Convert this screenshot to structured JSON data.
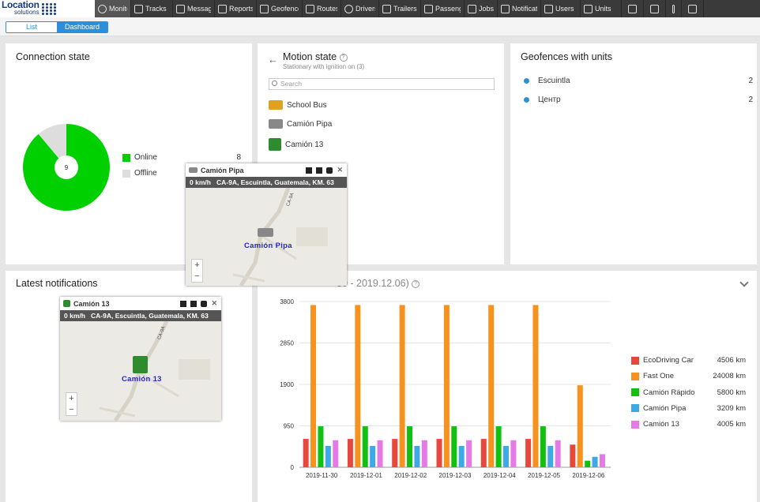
{
  "app": {
    "logo_line1": "Location",
    "logo_line2": "solutions"
  },
  "nav": [
    {
      "label": "Monitoring",
      "icon": "globe-icon",
      "active": true
    },
    {
      "label": "Tracks",
      "icon": "map-icon"
    },
    {
      "label": "Messages",
      "icon": "envelope-icon"
    },
    {
      "label": "Reports",
      "icon": "report-icon"
    },
    {
      "label": "Geofences",
      "icon": "geofence-icon"
    },
    {
      "label": "Routes",
      "icon": "route-icon"
    },
    {
      "label": "Drivers",
      "icon": "steering-wheel-icon"
    },
    {
      "label": "Trailers",
      "icon": "trailer-icon"
    },
    {
      "label": "Passengers",
      "icon": "passenger-icon"
    },
    {
      "label": "Jobs",
      "icon": "jobs-icon"
    },
    {
      "label": "Notifications",
      "icon": "alarm-icon"
    },
    {
      "label": "Users",
      "icon": "user-icon"
    },
    {
      "label": "Units",
      "icon": "bus-icon"
    }
  ],
  "nav_extra": [
    "ruler-icon",
    "grid-icon",
    "more-icon",
    "account-icon"
  ],
  "view_toggle": {
    "list": "List",
    "dashboard": "Dashboard",
    "selected": "dashboard"
  },
  "connection": {
    "title": "Connection state",
    "center": "9",
    "items": [
      {
        "label": "Online",
        "value": "8",
        "color": "#00d000"
      },
      {
        "label": "Offline",
        "value": "",
        "color": "#dddddd"
      }
    ],
    "fractions": [
      0.889,
      0.111
    ]
  },
  "motion": {
    "title": "Motion state",
    "subtitle": "Stationary with ignition on (3)",
    "search_placeholder": "Search",
    "units": [
      {
        "name": "School Bus",
        "icon": "school-bus-icon",
        "color": "#e0a020"
      },
      {
        "name": "Camión Pipa",
        "icon": "tanker-truck-icon",
        "color": "#888888"
      },
      {
        "name": "Camión 13",
        "icon": "truck-icon",
        "color": "#2e8b2e"
      }
    ]
  },
  "geofences": {
    "title": "Geofences with units",
    "items": [
      {
        "name": "Escuintla",
        "count": "2"
      },
      {
        "name": "Центр",
        "count": "2"
      }
    ]
  },
  "notifications": {
    "title": "Latest notifications"
  },
  "popup1": {
    "unit": "Camión Pipa",
    "speed": "0 km/h",
    "address": "CA-9A, Escuintla, Guatemala, KM. 63",
    "map_label": "Camión Pipa",
    "road_label": "CA-9A"
  },
  "popup2": {
    "unit": "Camión 13",
    "speed": "0 km/h",
    "address": "CA-9A, Escuintla, Guatemala, KM. 63",
    "map_label": "Camión 13",
    "road_label": "CA-9A"
  },
  "mileage": {
    "title_visible": "30 - 2019.12.06)"
  },
  "chart_data": {
    "type": "bar",
    "categories": [
      "2019-11-30",
      "2019-12-01",
      "2019-12-02",
      "2019-12-03",
      "2019-12-04",
      "2019-12-05",
      "2019-12-06"
    ],
    "ylim": [
      0,
      3800
    ],
    "yticks": [
      "0",
      "950",
      "1900",
      "2850",
      "3800"
    ],
    "ytick_values": [
      0,
      950,
      1900,
      2850,
      3800
    ],
    "series": [
      {
        "name": "EcoDriving Car",
        "total": "4506 km",
        "color": "#e8473e",
        "values": [
          650,
          650,
          650,
          650,
          650,
          650,
          520
        ]
      },
      {
        "name": "Fast One",
        "total": "24008 km",
        "color": "#f7921e",
        "values": [
          3720,
          3720,
          3720,
          3720,
          3720,
          3720,
          1880
        ]
      },
      {
        "name": "Camión Rápido",
        "total": "5800 km",
        "color": "#11c011",
        "values": [
          940,
          940,
          940,
          940,
          940,
          940,
          150
        ]
      },
      {
        "name": "Camión Pipa",
        "total": "3209 km",
        "color": "#3fa9e8",
        "values": [
          490,
          490,
          490,
          490,
          490,
          490,
          240
        ]
      },
      {
        "name": "Camión 13",
        "total": "4005 km",
        "color": "#e57ae6",
        "values": [
          620,
          620,
          620,
          620,
          620,
          620,
          300
        ]
      }
    ]
  }
}
